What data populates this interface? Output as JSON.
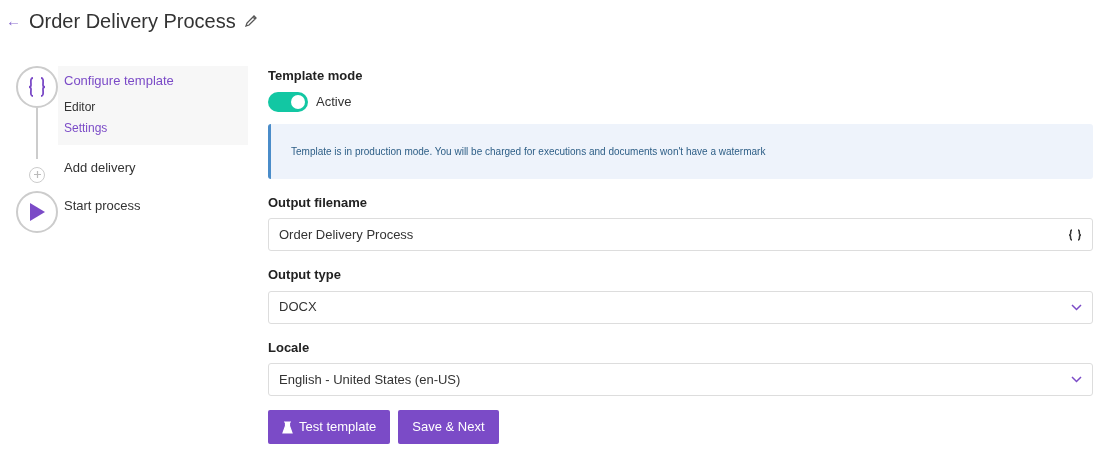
{
  "header": {
    "back": "←",
    "title": "Order Delivery Process"
  },
  "steps": [
    {
      "kind": "braces",
      "label": "Configure template",
      "selected": true,
      "children": [
        {
          "label": "Editor",
          "selected": false
        },
        {
          "label": "Settings",
          "selected": true
        }
      ]
    },
    {
      "kind": "plus",
      "label": "Add delivery",
      "selected": false
    },
    {
      "kind": "play",
      "label": "Start process",
      "selected": false
    }
  ],
  "template_mode": {
    "label": "Template mode",
    "on": true,
    "state_label": "Active"
  },
  "alert": "Template is in production mode. You will be charged for executions and documents won't have a watermark",
  "fields": [
    {
      "kind": "text",
      "label": "Output filename",
      "value": "Order Delivery Process"
    },
    {
      "kind": "select",
      "label": "Output type",
      "value": "DOCX"
    },
    {
      "kind": "select",
      "label": "Locale",
      "value": "English - United States (en-US)"
    }
  ],
  "buttons": [
    {
      "kind": "test",
      "label": "Test template"
    },
    {
      "kind": "plain",
      "label": "Save & Next"
    }
  ]
}
